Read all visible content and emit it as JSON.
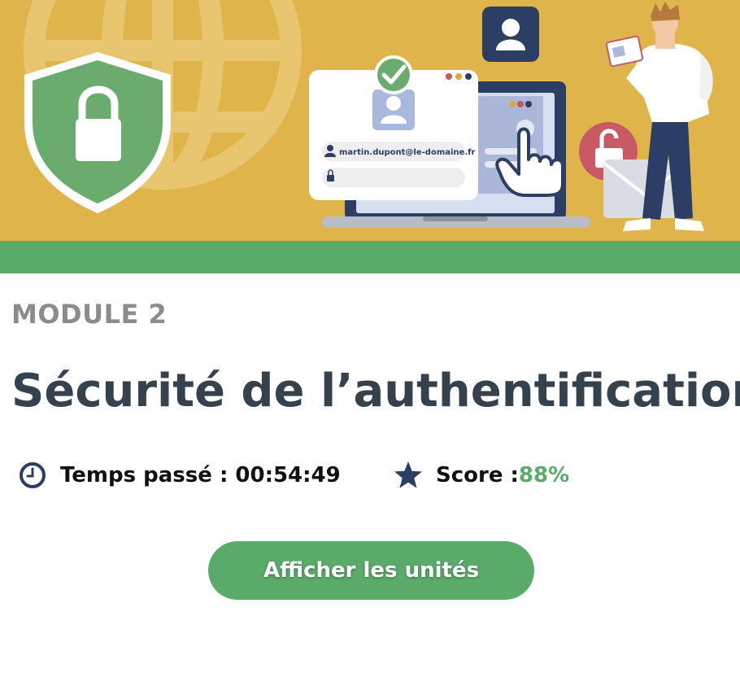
{
  "banner": {
    "email_field_value": "martin.dupont@le-domaine.fr",
    "colors": {
      "background": "#dfb54b",
      "band": "#5aab6a",
      "shield": "#6aac6e",
      "laptop": "#2c3e63"
    }
  },
  "module": {
    "label": "MODULE 2",
    "title": "Sécurité de l’authentification"
  },
  "stats": {
    "time_label": "Temps passé : 00:54:49",
    "score_label": "Score : ",
    "score_value": "88%"
  },
  "actions": {
    "show_units_label": "Afficher les unités"
  },
  "icons": {
    "time": "clock-icon",
    "score": "star-icon"
  }
}
